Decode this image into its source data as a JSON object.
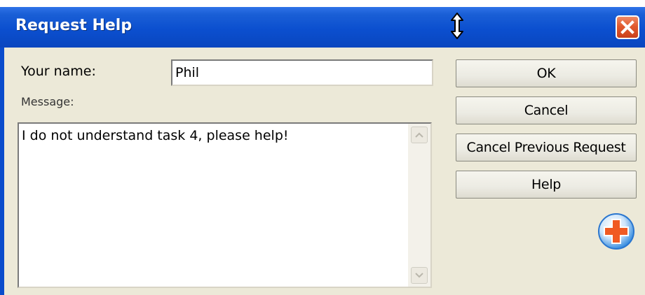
{
  "window": {
    "title": "Request Help"
  },
  "form": {
    "name_label": "Your name:",
    "name_value": "Phil",
    "message_label": "Message:",
    "message_value": "I do not understand task 4, please help!"
  },
  "buttons": {
    "ok": "OK",
    "cancel": "Cancel",
    "cancel_previous": "Cancel Previous Request",
    "help": "Help"
  },
  "icons": {
    "resize_cursor": "vertical-resize-cursor-icon",
    "close": "close-icon",
    "plus": "add-request-icon",
    "scroll_up": "scroll-up-icon",
    "scroll_down": "scroll-down-icon"
  },
  "colors": {
    "titlebar": "#0b4fcf",
    "window_bg": "#ece9d8",
    "close_button": "#e25a2e",
    "plus_icon": "#f05a22"
  }
}
